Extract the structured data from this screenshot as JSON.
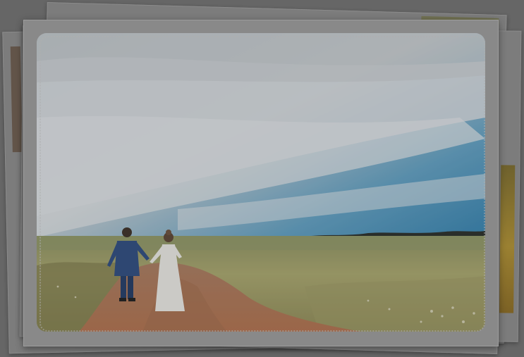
{
  "photo": {
    "subject": "couple-walking-on-dirt-road-through-field",
    "colors": {
      "sky_top": "#cfd6dc",
      "sky_blue": "#3d89b3",
      "cloud": "#dde2e6",
      "field": "#a9a66a",
      "field_dark": "#7b7c48",
      "road": "#b1775a",
      "trees": "#2c2f2a",
      "suit": "#2b4a7e",
      "dress": "#e8e6e1",
      "frame": "#9a9a9a"
    }
  }
}
